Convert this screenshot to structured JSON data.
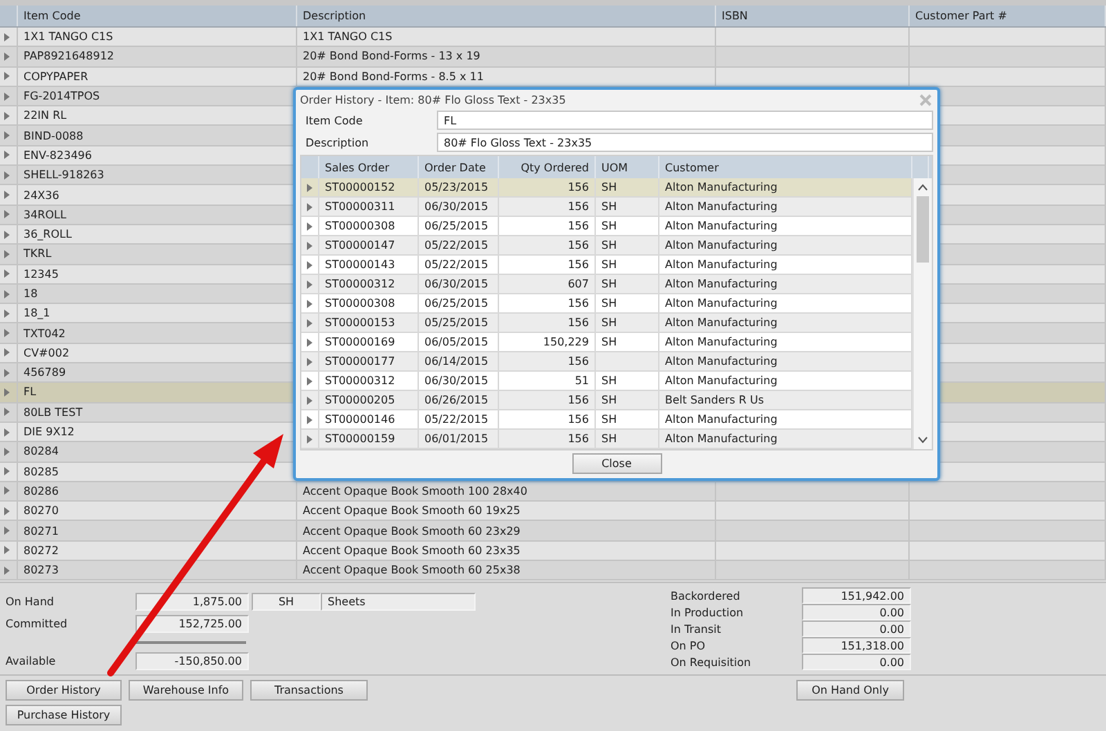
{
  "grid": {
    "columns": [
      "Item Code",
      "Description",
      "ISBN",
      "Customer Part #"
    ],
    "rows": [
      {
        "code": "1X1 TANGO C1S",
        "description": "1X1 TANGO C1S",
        "selected": false
      },
      {
        "code": "PAP8921648912",
        "description": "20#  Bond Bond-Forms - 13 x 19",
        "selected": false
      },
      {
        "code": "COPYPAPER",
        "description": "20#  Bond Bond-Forms - 8.5 x 11",
        "selected": false
      },
      {
        "code": "FG-2014TPOS",
        "selected": false
      },
      {
        "code": "22IN RL",
        "selected": false
      },
      {
        "code": "BIND-0088",
        "selected": false
      },
      {
        "code": "ENV-823496",
        "selected": false
      },
      {
        "code": "SHELL-918263",
        "selected": false
      },
      {
        "code": "24X36",
        "selected": false
      },
      {
        "code": "34ROLL",
        "selected": false
      },
      {
        "code": "36_ROLL",
        "selected": false
      },
      {
        "code": "TKRL",
        "selected": false
      },
      {
        "code": "12345",
        "selected": false
      },
      {
        "code": "18",
        "selected": false
      },
      {
        "code": "18_1",
        "selected": false
      },
      {
        "code": "TXT042",
        "selected": false
      },
      {
        "code": "CV#002",
        "selected": false
      },
      {
        "code": "456789",
        "selected": false
      },
      {
        "code": "FL",
        "selected": true
      },
      {
        "code": "80LB TEST",
        "selected": false
      },
      {
        "code": "DIE 9X12",
        "selected": false
      },
      {
        "code": "80284",
        "selected": false
      },
      {
        "code": "80285",
        "selected": false
      },
      {
        "code": "80286",
        "description": "Accent Opaque Book Smooth 100 28x40",
        "selected": false
      },
      {
        "code": "80270",
        "description": "Accent Opaque Book Smooth 60 19x25",
        "selected": false
      },
      {
        "code": "80271",
        "description": "Accent Opaque Book Smooth 60 23x29",
        "selected": false
      },
      {
        "code": "80272",
        "description": "Accent Opaque Book Smooth 60 23x35",
        "selected": false
      },
      {
        "code": "80273",
        "description": "Accent Opaque Book Smooth 60 25x38",
        "selected": false
      }
    ]
  },
  "stock": {
    "left": [
      {
        "label": "On Hand",
        "value": "1,875.00"
      },
      {
        "label": "Committed",
        "value": "152,725.00"
      },
      {
        "label": "Available",
        "value": "-150,850.00"
      }
    ],
    "unit": "SH",
    "unit_name": "Sheets",
    "right": [
      {
        "label": "Backordered",
        "value": "151,942.00"
      },
      {
        "label": "In Production",
        "value": "0.00"
      },
      {
        "label": "In Transit",
        "value": "0.00"
      },
      {
        "label": "On PO",
        "value": "151,318.00"
      },
      {
        "label": "On Requisition",
        "value": "0.00"
      }
    ]
  },
  "buttons": [
    "Order History",
    "Warehouse Info",
    "Transactions",
    "Purchase History"
  ],
  "right_button": "On Hand Only",
  "dialog": {
    "title": "Order History - Item: 80# Flo Gloss Text - 23x35",
    "fields": [
      {
        "label": "Item Code",
        "value": "FL"
      },
      {
        "label": "Description",
        "value": "80# Flo Gloss Text - 23x35"
      }
    ],
    "columns": [
      "Sales Order",
      "Order Date",
      "Qty Ordered",
      "UOM",
      "Customer"
    ],
    "rows": [
      {
        "order": "ST00000152",
        "date": "05/23/2015",
        "qty": "156",
        "uom": "SH",
        "customer": "Alton Manufacturing",
        "selected": true
      },
      {
        "order": "ST00000311",
        "date": "06/30/2015",
        "qty": "156",
        "uom": "SH",
        "customer": "Alton Manufacturing",
        "selected": false
      },
      {
        "order": "ST00000308",
        "date": "06/25/2015",
        "qty": "156",
        "uom": "SH",
        "customer": "Alton Manufacturing",
        "selected": false
      },
      {
        "order": "ST00000147",
        "date": "05/22/2015",
        "qty": "156",
        "uom": "SH",
        "customer": "Alton Manufacturing",
        "selected": false
      },
      {
        "order": "ST00000143",
        "date": "05/22/2015",
        "qty": "156",
        "uom": "SH",
        "customer": "Alton Manufacturing",
        "selected": false
      },
      {
        "order": "ST00000312",
        "date": "06/30/2015",
        "qty": "607",
        "uom": "SH",
        "customer": "Alton Manufacturing",
        "selected": false
      },
      {
        "order": "ST00000308",
        "date": "06/25/2015",
        "qty": "156",
        "uom": "SH",
        "customer": "Alton Manufacturing",
        "selected": false
      },
      {
        "order": "ST00000153",
        "date": "05/25/2015",
        "qty": "156",
        "uom": "SH",
        "customer": "Alton Manufacturing",
        "selected": false
      },
      {
        "order": "ST00000169",
        "date": "06/05/2015",
        "qty": "150,229",
        "uom": "SH",
        "customer": "Alton Manufacturing",
        "selected": false
      },
      {
        "order": "ST00000177",
        "date": "06/14/2015",
        "qty": "156",
        "customer": "Alton Manufacturing",
        "selected": false
      },
      {
        "order": "ST00000312",
        "date": "06/30/2015",
        "qty": "51",
        "uom": "SH",
        "customer": "Alton Manufacturing",
        "selected": false
      },
      {
        "order": "ST00000205",
        "date": "06/26/2015",
        "qty": "156",
        "uom": "SH",
        "customer": "Belt Sanders R Us",
        "selected": false
      },
      {
        "order": "ST00000146",
        "date": "05/22/2015",
        "qty": "156",
        "uom": "SH",
        "customer": "Alton Manufacturing",
        "selected": false
      },
      {
        "order": "ST00000159",
        "date": "06/01/2015",
        "qty": "156",
        "uom": "SH",
        "customer": "Alton Manufacturing",
        "selected": false
      }
    ],
    "close_label": "Close"
  }
}
